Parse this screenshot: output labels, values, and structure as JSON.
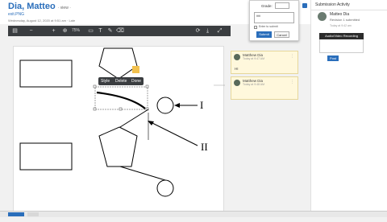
{
  "header": {
    "title": "Dia, Matteo",
    "title_menu": "· view ·",
    "file_name": "exit.PNG",
    "submitted": "Wednesday, August 12, 2020 at 9:51 am · Late"
  },
  "toolbar": {
    "zoom": "75%",
    "icons": [
      "page-icon",
      "zoom-out-icon",
      "zoom-in-icon",
      "pointer-icon",
      "highlight-icon",
      "text-icon",
      "draw-icon",
      "eraser-icon",
      "rotate-icon",
      "download-icon",
      "fullscreen-icon"
    ]
  },
  "context_menu": {
    "items": [
      "Style",
      "Delete",
      "Done"
    ]
  },
  "diagram": {
    "label_1": "I",
    "label_2": "II"
  },
  "comments": [
    {
      "author": "Matthew Dia",
      "date": "Today at 9:47 AM",
      "text": "HI"
    },
    {
      "author": "Matthew Dia",
      "date": "Today at 9:48 AM",
      "text": ""
    }
  ],
  "grade_panel": {
    "label": "Grade:",
    "value": "",
    "comment": "ttttt",
    "checkbox_label": "Enter to submit",
    "submit": "Submit",
    "cancel": "Cancel"
  },
  "sidebar": {
    "title": "Submission Activity",
    "student_name": "Matteo Dia",
    "submission_info": "Revision 1 submitted",
    "submission_date": "Today at 9:42 am",
    "tooltip": "Audio/Video Recording",
    "post_button": "Post"
  },
  "colors": {
    "accent": "#2a6ebb",
    "toolbar_bg": "#3a3d40",
    "comment_bg": "#fff8dc",
    "highlight_square": "#f2c14e"
  }
}
